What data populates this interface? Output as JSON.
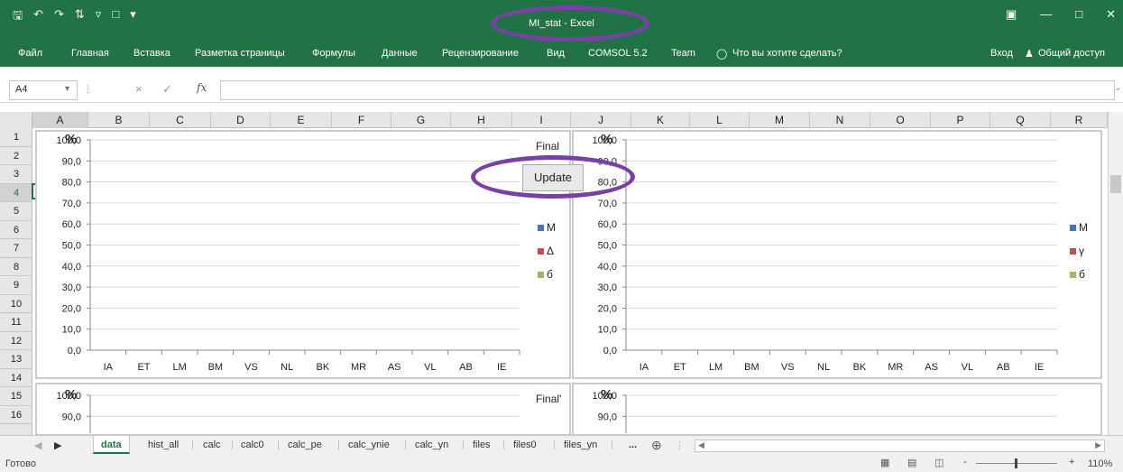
{
  "window": {
    "title": "MI_stat - Excel"
  },
  "quick_access": {
    "save_icon": "save-icon",
    "undo_icon": "undo-icon",
    "redo_icon": "redo-icon",
    "sort_icon": "sort-icon",
    "filter_icon": "filter-icon",
    "new_icon": "new-file-icon",
    "customize_icon": "customize-qat-icon"
  },
  "window_controls": {
    "ribbon_display_icon": "ribbon-display-icon",
    "minimize_icon": "minimize-icon",
    "maximize_icon": "maximize-icon",
    "close_icon": "close-icon"
  },
  "ribbon": {
    "tabs": [
      "Файл",
      "Главная",
      "Вставка",
      "Разметка страницы",
      "Формулы",
      "Данные",
      "Рецензирование",
      "Вид",
      "COMSOL 5.2",
      "Team"
    ],
    "tell_me": "Что вы хотите сделать?",
    "sign_in": "Вход",
    "share": "Общий доступ"
  },
  "formula_bar": {
    "name_box": "A4",
    "fx": "fx",
    "cancel": "×",
    "enter": "✓",
    "value": ""
  },
  "columns": [
    "A",
    "B",
    "C",
    "D",
    "E",
    "F",
    "G",
    "H",
    "I",
    "J",
    "K",
    "L",
    "M",
    "N",
    "O",
    "P",
    "Q",
    "R"
  ],
  "selected_column": "A",
  "rows": [
    "1",
    "2",
    "3",
    "4",
    "5",
    "6",
    "7",
    "8",
    "9",
    "10",
    "11",
    "12",
    "13",
    "14",
    "15",
    "16"
  ],
  "selected_row": "4",
  "charts": {
    "chart1": {
      "title": "Final",
      "unit": "%",
      "legend": [
        "M",
        "Δ",
        "б"
      ],
      "legend_colors": [
        "#4472c4",
        "#c0504d",
        "#9bbb59"
      ]
    },
    "chart2": {
      "unit": "%",
      "legend": [
        "M",
        "γ",
        "б"
      ],
      "legend_colors": [
        "#4472c4",
        "#c0504d",
        "#9bbb59"
      ]
    },
    "chart3": {
      "title": "Final'",
      "unit": "%"
    },
    "chart4": {
      "unit": "%"
    }
  },
  "chart_data": [
    {
      "type": "bar",
      "title": "Final",
      "categories": [
        "IA",
        "ET",
        "LM",
        "BM",
        "VS",
        "NL",
        "BK",
        "MR",
        "AS",
        "VL",
        "AB",
        "IE"
      ],
      "series": [
        {
          "name": "M",
          "values": []
        },
        {
          "name": "Δ",
          "values": []
        },
        {
          "name": "б",
          "values": []
        }
      ],
      "ylabel": "%",
      "yticks": [
        "100,0",
        "90,0",
        "80,0",
        "70,0",
        "60,0",
        "50,0",
        "40,0",
        "30,0",
        "20,0",
        "10,0",
        "0,0"
      ],
      "ylim": [
        0,
        100
      ],
      "grid": true,
      "legend": "right"
    },
    {
      "type": "bar",
      "title": "",
      "categories": [
        "IA",
        "ET",
        "LM",
        "BM",
        "VS",
        "NL",
        "BK",
        "MR",
        "AS",
        "VL",
        "AB",
        "IE"
      ],
      "series": [
        {
          "name": "M",
          "values": []
        },
        {
          "name": "γ",
          "values": []
        },
        {
          "name": "б",
          "values": []
        }
      ],
      "ylabel": "%",
      "yticks": [
        "100,0",
        "90,0",
        "80,0",
        "70,0",
        "60,0",
        "50,0",
        "40,0",
        "30,0",
        "20,0",
        "10,0",
        "0,0"
      ],
      "ylim": [
        0,
        100
      ],
      "grid": true,
      "legend": "right"
    },
    {
      "type": "bar",
      "title": "Final'",
      "categories": [],
      "series": [],
      "ylabel": "%",
      "yticks": [
        "100,0",
        "90,0"
      ],
      "ylim": [
        0,
        100
      ],
      "grid": true
    },
    {
      "type": "bar",
      "title": "",
      "categories": [],
      "series": [],
      "ylabel": "%",
      "yticks": [
        "100,0",
        "90,0"
      ],
      "ylim": [
        0,
        100
      ],
      "grid": true
    }
  ],
  "update_button": "Update",
  "sheets": {
    "tabs": [
      "data",
      "hist_all",
      "calc",
      "calc0",
      "calc_pe",
      "calc_ynie",
      "calc_yn",
      "files",
      "files0",
      "files_yn"
    ],
    "active": "data",
    "more": "...",
    "add_icon": "plus-circle-icon"
  },
  "status": {
    "ready": "Готово",
    "zoom": "110%",
    "view_icons": [
      "normal-view-icon",
      "page-layout-icon",
      "page-break-icon"
    ],
    "zoom_minus": "-",
    "zoom_plus": "+"
  },
  "accent": "#217346",
  "annotation_color": "#7b3fa8"
}
